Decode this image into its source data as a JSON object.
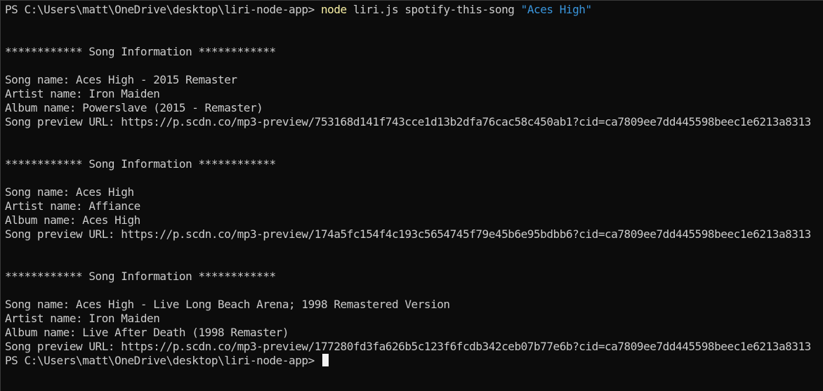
{
  "terminal": {
    "prompt": "PS C:\\Users\\matt\\OneDrive\\desktop\\liri-node-app>",
    "command": {
      "program": "node",
      "args": "liri.js spotify-this-song",
      "string_arg": "\"Aces High\""
    },
    "results": [
      {
        "header": "************ Song Information ************",
        "song": "Song name: Aces High - 2015 Remaster",
        "artist": "Artist name: Iron Maiden",
        "album": "Album name: Powerslave (2015 - Remaster)",
        "preview": "Song preview URL: https://p.scdn.co/mp3-preview/753168d141f743cce1d13b2dfa76cac58c450ab1?cid=ca7809ee7dd445598beec1e6213a8313"
      },
      {
        "header": "************ Song Information ************",
        "song": "Song name: Aces High",
        "artist": "Artist name: Affiance",
        "album": "Album name: Aces High",
        "preview": "Song preview URL: https://p.scdn.co/mp3-preview/174a5fc154f4c193c5654745f79e45b6e95bdbb6?cid=ca7809ee7dd445598beec1e6213a8313"
      },
      {
        "header": "************ Song Information ************",
        "song": "Song name: Aces High - Live Long Beach Arena; 1998 Remastered Version",
        "artist": "Artist name: Iron Maiden",
        "album": "Album name: Live After Death (1998 Remaster)",
        "preview": "Song preview URL: https://p.scdn.co/mp3-preview/177280fd3fa626b5c123f6fcdb342ceb07b77e6b?cid=ca7809ee7dd445598beec1e6213a8313"
      }
    ],
    "colors": {
      "background": "#0c0c0c",
      "text": "#cccccc",
      "command": "#f9f1a5",
      "string": "#3a96dd",
      "cursor": "#f2f2f2"
    }
  }
}
